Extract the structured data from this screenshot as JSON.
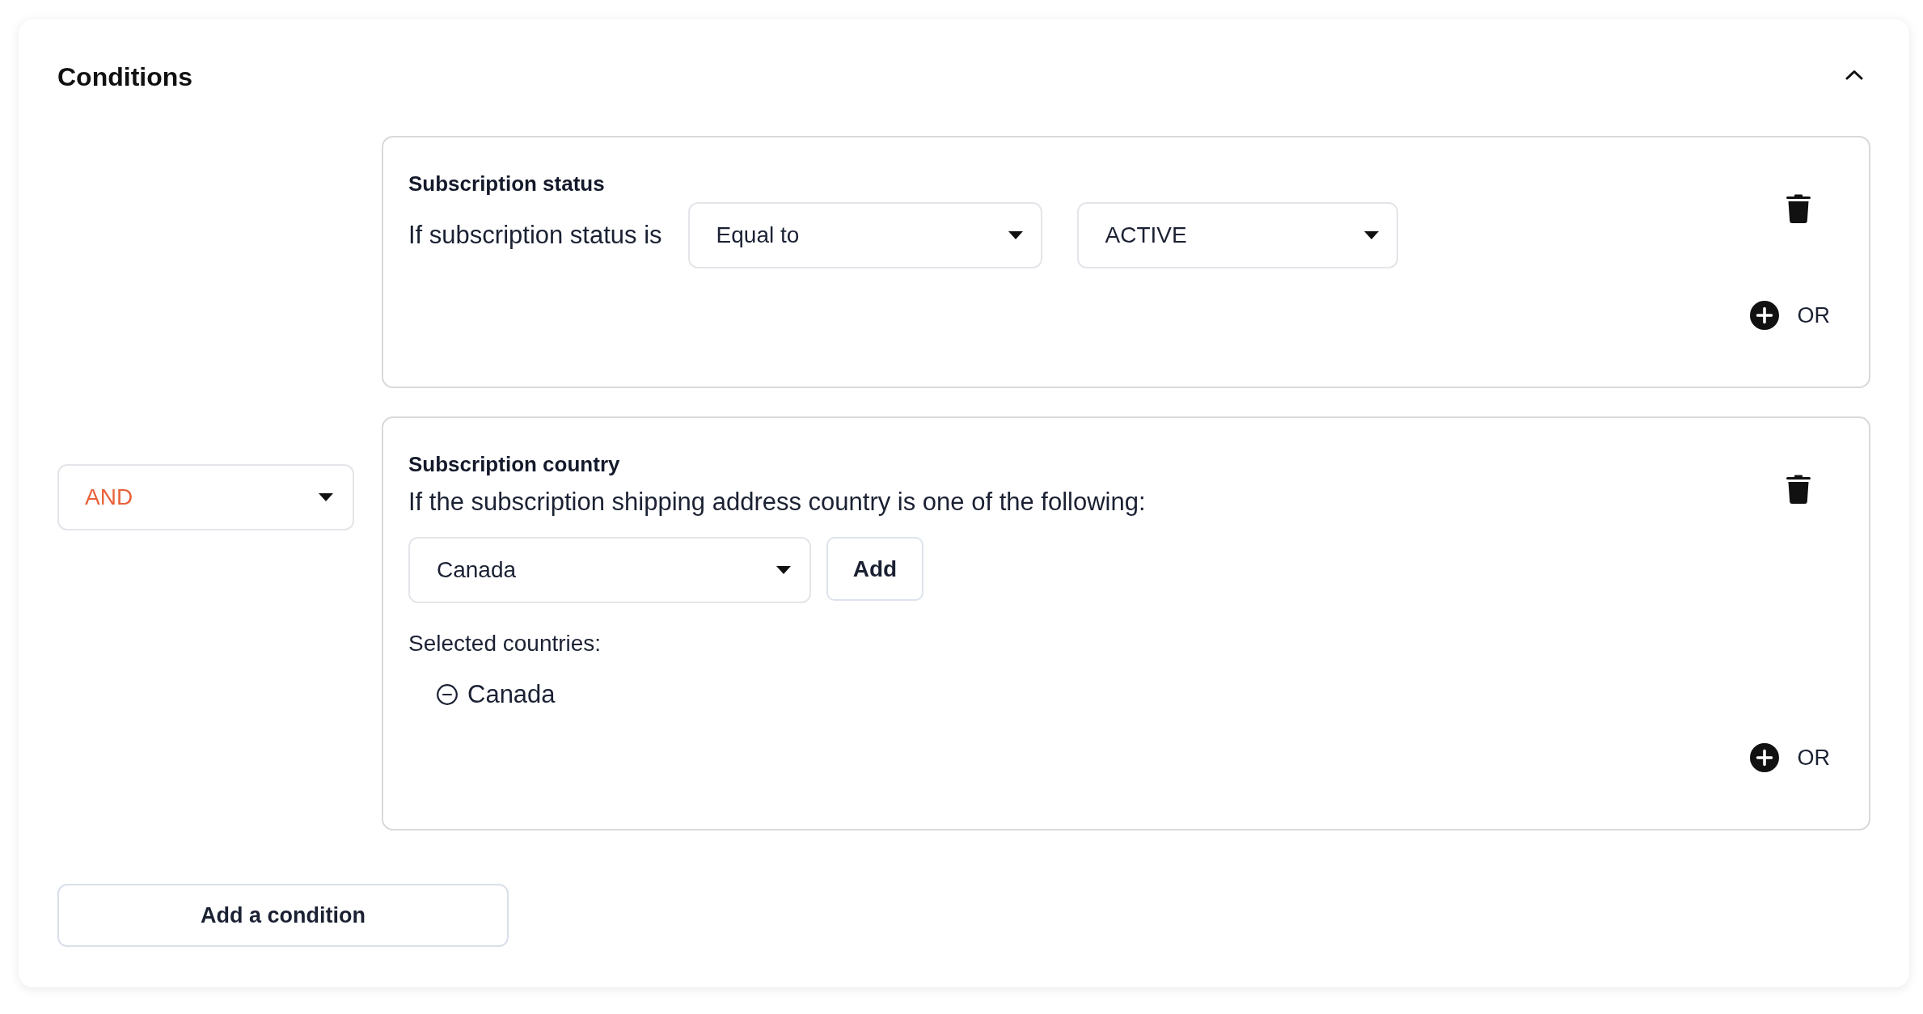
{
  "panel": {
    "title": "Conditions",
    "expanded": true
  },
  "conditions": [
    {
      "kind": "compare",
      "title": "Subscription status",
      "description": "If subscription status is",
      "selects": [
        {
          "value": "Equal to"
        },
        {
          "value": "ACTIVE"
        }
      ],
      "or_button": "OR"
    },
    {
      "kind": "country_list",
      "connector": "AND",
      "title": "Subscription country",
      "description": "If the subscription shipping address country is one of the following:",
      "select": {
        "value": "Canada"
      },
      "add_button": "Add",
      "selected_label": "Selected countries:",
      "selected_countries": [
        "Canada"
      ],
      "or_button": "OR"
    }
  ],
  "add_condition_button": "Add a condition"
}
